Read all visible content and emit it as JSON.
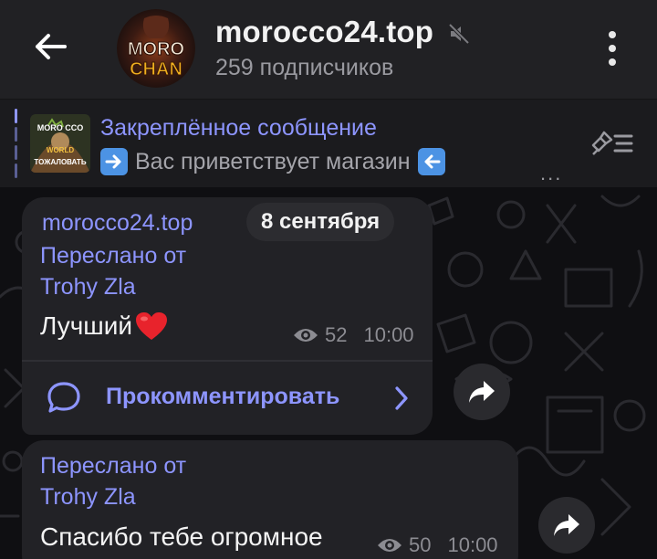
{
  "header": {
    "title": "morocco24.top",
    "subscribers": "259 подписчиков",
    "back_icon": "arrow-left-icon",
    "mute_icon": "muted-speaker-icon",
    "more_icon": "more-vertical-icon",
    "avatar_text_top": "MORO",
    "avatar_text_bottom": "CHAN"
  },
  "pinned": {
    "title": "Закреплённое сообщение",
    "text_before": "➡️",
    "text": "Вас приветствует магазин",
    "text_after": "⬅️",
    "ellipsis": "...",
    "thumb_text_top": "MORO CCO",
    "thumb_text_mid": "WORLD",
    "thumb_text_bottom": "ТОЖАЛОВАТЬ",
    "list_icon": "pin-list-icon"
  },
  "date_separator": "8 сентября",
  "messages": [
    {
      "author": "morocco24.top",
      "forwarded_label": "Переслано от",
      "forwarded_from": "Trohy Zla",
      "text": "Лучший",
      "emoji": "heart",
      "views": "52",
      "time": "10:00",
      "comment_label": "Прокомментировать"
    },
    {
      "forwarded_label": "Переслано от",
      "forwarded_from": "Trohy Zla",
      "text": "Спасибо тебе огромное",
      "views": "50",
      "time": "10:00"
    }
  ],
  "colors": {
    "accent": "#8d95ff",
    "header_bg": "#212124",
    "bubble_bg": "#222226",
    "heart": "#e8232c"
  }
}
